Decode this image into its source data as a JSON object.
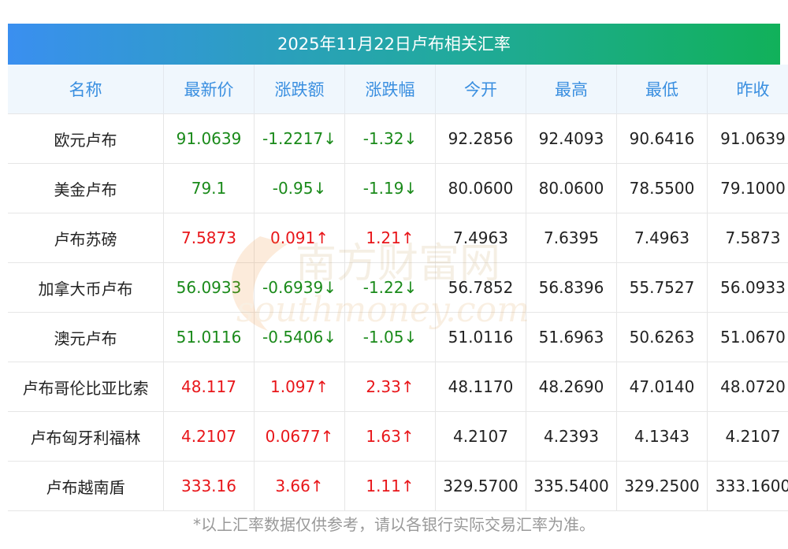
{
  "title": "2025年11月22日卢布相关汇率",
  "headers": [
    "名称",
    "最新价",
    "涨跌额",
    "涨跌幅",
    "今开",
    "最高",
    "最低",
    "昨收"
  ],
  "rows": [
    {
      "name": "欧元卢布",
      "latest": "91.0639",
      "change": "-1.2217↓",
      "pct": "-1.32↓",
      "open": "92.2856",
      "high": "92.4093",
      "low": "90.6416",
      "prev": "91.0639",
      "dir": "down"
    },
    {
      "name": "美金卢布",
      "latest": "79.1",
      "change": "-0.95↓",
      "pct": "-1.19↓",
      "open": "80.0600",
      "high": "80.0600",
      "low": "78.5500",
      "prev": "79.1000",
      "dir": "down"
    },
    {
      "name": "卢布苏磅",
      "latest": "7.5873",
      "change": "0.091↑",
      "pct": "1.21↑",
      "open": "7.4963",
      "high": "7.6395",
      "low": "7.4963",
      "prev": "7.5873",
      "dir": "up"
    },
    {
      "name": "加拿大币卢布",
      "latest": "56.0933",
      "change": "-0.6939↓",
      "pct": "-1.22↓",
      "open": "56.7852",
      "high": "56.8396",
      "low": "55.7527",
      "prev": "56.0933",
      "dir": "down"
    },
    {
      "name": "澳元卢布",
      "latest": "51.0116",
      "change": "-0.5406↓",
      "pct": "-1.05↓",
      "open": "51.0116",
      "high": "51.6963",
      "low": "50.6263",
      "prev": "51.0670",
      "dir": "down"
    },
    {
      "name": "卢布哥伦比亚比索",
      "latest": "48.117",
      "change": "1.097↑",
      "pct": "2.33↑",
      "open": "48.1170",
      "high": "48.2690",
      "low": "47.0140",
      "prev": "48.0720",
      "dir": "up"
    },
    {
      "name": "卢布匈牙利福林",
      "latest": "4.2107",
      "change": "0.0677↑",
      "pct": "1.63↑",
      "open": "4.2107",
      "high": "4.2393",
      "low": "4.1343",
      "prev": "4.2107",
      "dir": "up"
    },
    {
      "name": "卢布越南盾",
      "latest": "333.16",
      "change": "3.66↑",
      "pct": "1.11↑",
      "open": "329.5700",
      "high": "335.5400",
      "low": "329.2500",
      "prev": "333.1600",
      "dir": "up"
    }
  ],
  "footnote": "*以上汇率数据仅供参考，请以各银行实际交易汇率为准。",
  "watermark": {
    "cn": "南方财富网",
    "en": "southmoney.com"
  },
  "colors": {
    "up": "#e8161a",
    "down": "#1a8a1a",
    "header_text": "#3a8fe0",
    "banner_start": "#3a8ff0",
    "banner_end": "#11b15a"
  }
}
